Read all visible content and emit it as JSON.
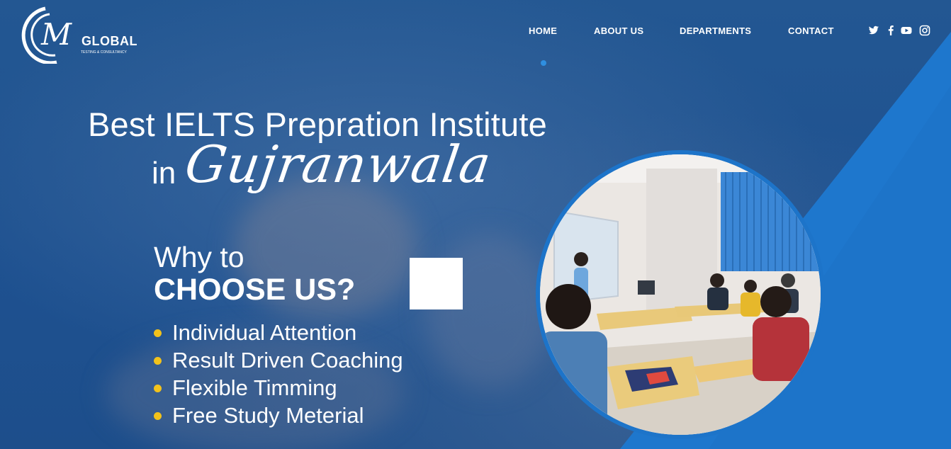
{
  "brand": {
    "logo_letters": "M",
    "logo_name": "GLOBAL",
    "logo_tagline": "TESTING & CONSULTANCY"
  },
  "nav": {
    "items": [
      {
        "label": "HOME"
      },
      {
        "label": "ABOUT US"
      },
      {
        "label": "DEPARTMENTS"
      },
      {
        "label": "CONTACT"
      }
    ],
    "active_index": 0
  },
  "social": [
    "twitter-icon",
    "facebook-icon",
    "youtube-icon",
    "instagram-icon"
  ],
  "hero": {
    "headline": "Best IELTS Prepration Institute",
    "in_word": "in",
    "city": "Gujranwala",
    "why_line1": "Why to",
    "why_line2": "CHOOSE US?",
    "features": [
      "Individual Attention",
      "Result Driven Coaching",
      "Flexible Timming",
      "Free Study Meterial"
    ]
  },
  "colors": {
    "background": "#1f4f8b",
    "accent_blue": "#1d74c9",
    "bullet_yellow": "#f2c21b",
    "nav_active_dot": "#2f8fe0"
  }
}
